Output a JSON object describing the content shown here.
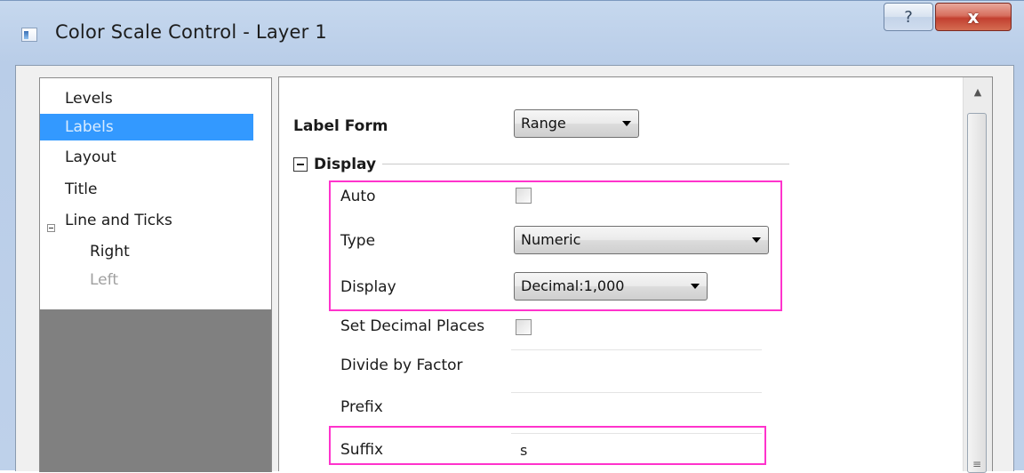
{
  "window": {
    "title": "Color Scale Control - Layer 1",
    "help_label": "?",
    "close_label": "x"
  },
  "tree": {
    "items": [
      {
        "label": "Levels"
      },
      {
        "label": "Labels",
        "selected": true
      },
      {
        "label": "Layout"
      },
      {
        "label": "Title"
      },
      {
        "label": "Line and Ticks"
      },
      {
        "label": "Right"
      },
      {
        "label": "Left",
        "disabled": true
      }
    ]
  },
  "properties": {
    "label_form": {
      "label": "Label Form",
      "value": "Range"
    },
    "display_group": {
      "label": "Display"
    },
    "auto": {
      "label": "Auto",
      "checked": false
    },
    "type": {
      "label": "Type",
      "value": "Numeric"
    },
    "display": {
      "label": "Display",
      "value": "Decimal:1,000"
    },
    "set_decimal_places": {
      "label": "Set Decimal Places",
      "checked": false
    },
    "divide_by_factor": {
      "label": "Divide by Factor",
      "value": ""
    },
    "prefix": {
      "label": "Prefix",
      "value": ""
    },
    "suffix": {
      "label": "Suffix",
      "value": "s"
    }
  },
  "colors": {
    "highlight": "#ff33cc",
    "selection": "#3399ff",
    "close_button": "#c24030"
  }
}
